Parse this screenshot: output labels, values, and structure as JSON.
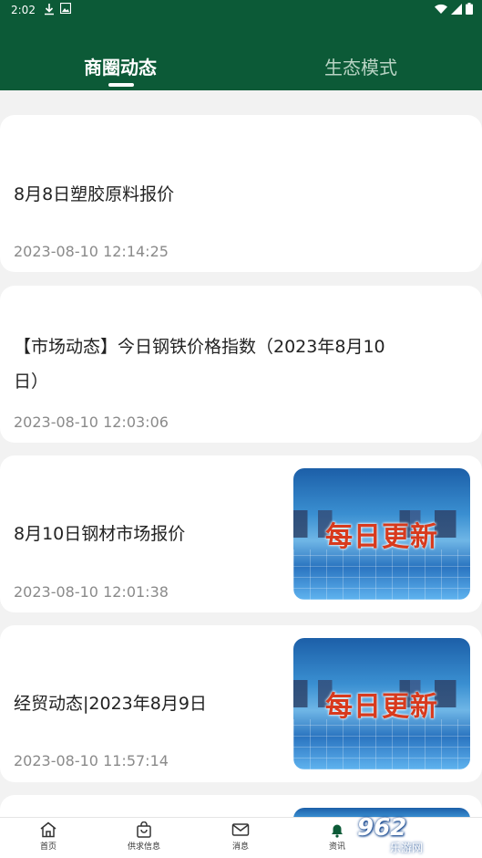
{
  "status_bar": {
    "time": "2:02",
    "icons": [
      "download-icon",
      "image-icon",
      "wifi-icon",
      "signal-icon",
      "battery-icon"
    ]
  },
  "tabs": [
    {
      "label": "商圈动态",
      "active": true
    },
    {
      "label": "生态模式",
      "active": false
    }
  ],
  "feed": [
    {
      "title": "8月8日塑胶原料报价",
      "time": "2023-08-10 12:14:25",
      "thumbnail": null
    },
    {
      "title_line1": "【市场动态】今日钢铁价格指数（2023年8月10",
      "title_line2": "日）",
      "time": "2023-08-10 12:03:06",
      "thumbnail": null
    },
    {
      "title": "8月10日钢材市场报价",
      "time": "2023-08-10 12:01:38",
      "thumbnail": "每日更新"
    },
    {
      "title": "经贸动态|2023年8月9日",
      "time": "2023-08-10 11:57:14",
      "thumbnail": "每日更新"
    }
  ],
  "bottom_nav": [
    {
      "label": "首页",
      "icon": "home-icon"
    },
    {
      "label": "供求信息",
      "icon": "shopping-bag-icon"
    },
    {
      "label": "消息",
      "icon": "mail-icon"
    },
    {
      "label": "资讯",
      "icon": "bell-icon"
    }
  ],
  "watermark": {
    "logo": "962",
    "site": "乐游网"
  },
  "colors": {
    "header": "#0c5a37",
    "thumb_text": "#d83a1d"
  }
}
